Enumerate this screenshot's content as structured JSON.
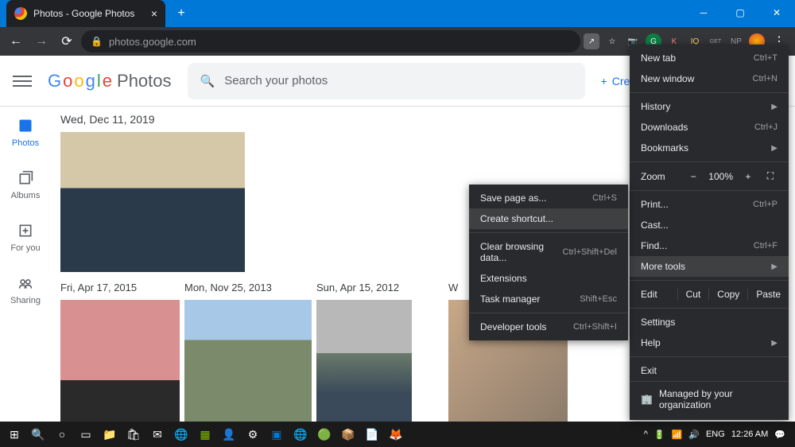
{
  "window": {
    "tab_title": "Photos - Google Photos",
    "url": "photos.google.com"
  },
  "app": {
    "logo_text": "Photos",
    "search_placeholder": "Search your photos",
    "create_label": "Create"
  },
  "sidebar": {
    "items": [
      {
        "label": "Photos"
      },
      {
        "label": "Albums"
      },
      {
        "label": "For you"
      },
      {
        "label": "Sharing"
      }
    ]
  },
  "dates": {
    "main": "Wed, Dec 11, 2019",
    "cols": [
      "Fri, Apr 17, 2015",
      "Mon, Nov 25, 2013",
      "Sun, Apr 15, 2012",
      "W"
    ]
  },
  "chrome_menu": {
    "new_tab": {
      "label": "New tab",
      "shortcut": "Ctrl+T"
    },
    "new_window": {
      "label": "New window",
      "shortcut": "Ctrl+N"
    },
    "history": {
      "label": "History"
    },
    "downloads": {
      "label": "Downloads",
      "shortcut": "Ctrl+J"
    },
    "bookmarks": {
      "label": "Bookmarks"
    },
    "zoom": {
      "label": "Zoom",
      "value": "100%"
    },
    "print": {
      "label": "Print...",
      "shortcut": "Ctrl+P"
    },
    "cast": {
      "label": "Cast..."
    },
    "find": {
      "label": "Find...",
      "shortcut": "Ctrl+F"
    },
    "more_tools": {
      "label": "More tools"
    },
    "edit": {
      "label": "Edit",
      "cut": "Cut",
      "copy": "Copy",
      "paste": "Paste"
    },
    "settings": {
      "label": "Settings"
    },
    "help": {
      "label": "Help"
    },
    "exit": {
      "label": "Exit"
    },
    "managed": {
      "label": "Managed by your organization"
    }
  },
  "submenu": {
    "save_page": {
      "label": "Save page as...",
      "shortcut": "Ctrl+S"
    },
    "create_shortcut": {
      "label": "Create shortcut..."
    },
    "clear_data": {
      "label": "Clear browsing data...",
      "shortcut": "Ctrl+Shift+Del"
    },
    "extensions": {
      "label": "Extensions"
    },
    "task_manager": {
      "label": "Task manager",
      "shortcut": "Shift+Esc"
    },
    "dev_tools": {
      "label": "Developer tools",
      "shortcut": "Ctrl+Shift+I"
    }
  },
  "taskbar": {
    "lang": "ENG",
    "time": "12:26 AM"
  },
  "ext_labels": [
    "K",
    "IQ",
    "GET",
    "NP"
  ]
}
